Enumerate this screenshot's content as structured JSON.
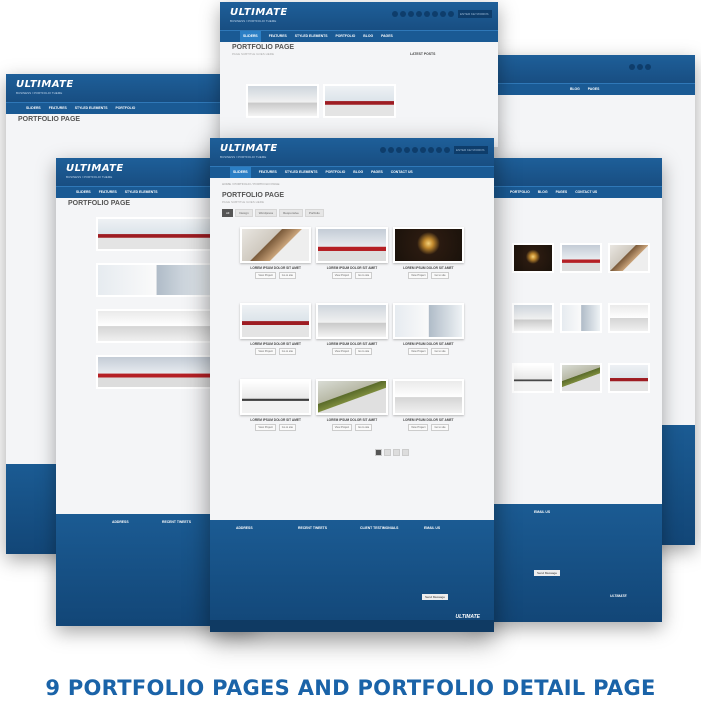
{
  "caption": "9 PORTFOLIO PAGES AND PORTFOLIO DETAIL PAGE",
  "mockup": {
    "logo": "ULTIMATE",
    "tagline": "BUSINESS / PORTFOLIO THEME",
    "search_placeholder": "ENTER KEYWORDS",
    "nav": [
      "SLIDERS",
      "FEATURES",
      "STYLED ELEMENTS",
      "PORTFOLIO",
      "BLOG",
      "PAGES",
      "CONTACT US"
    ],
    "breadcrumb": "HOME / PORTFOLIO / PORTFOLIO PAGE",
    "page_title": "PORTFOLIO PAGE",
    "page_subtitle": "PAGE SUBTITLE GOES HERE",
    "filters": [
      "All",
      "Design",
      "Wordpress",
      "Responsive",
      "Portfolio"
    ],
    "item_caption": "LOREM IPSUM DOLOR SIT AMET",
    "btn_view": "View Project",
    "btn_go": "Go to site",
    "footer": {
      "address": "ADDRESS",
      "tweets": "RECENT TWEETS",
      "testimonials": "CLIENT TESTIMONIALS",
      "email": "EMAIL US",
      "send": "Send Message",
      "footer_logo": "ULTIMATE"
    },
    "sidebar_title": "LATEST POSTS",
    "accent": "#1a5a94"
  }
}
